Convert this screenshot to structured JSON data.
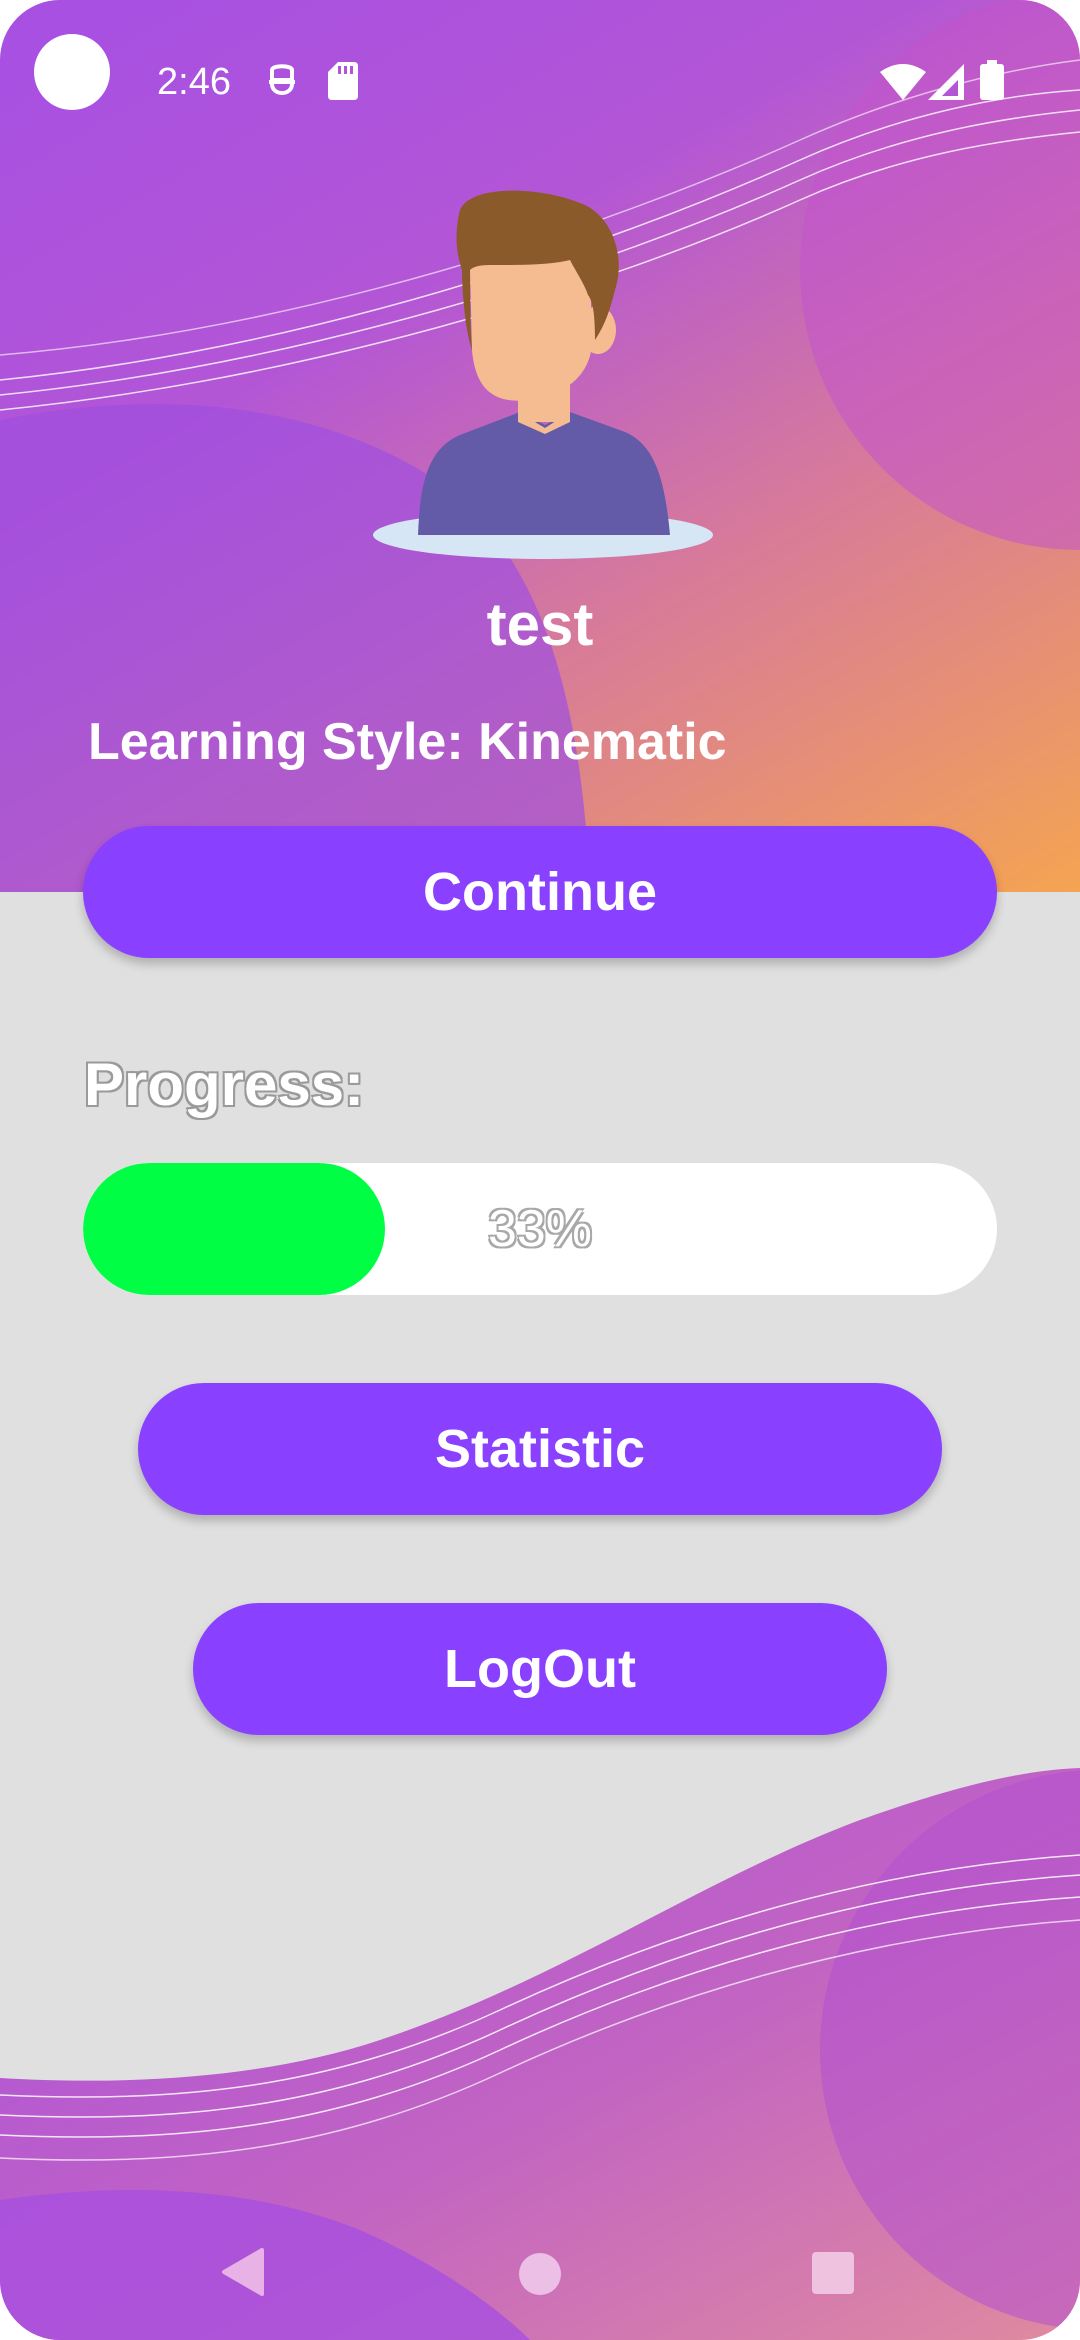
{
  "status_bar": {
    "time": "2:46",
    "icons": [
      "camera-hole",
      "notification-icon",
      "sd-card-icon",
      "wifi-icon",
      "cell-signal-icon",
      "battery-icon"
    ]
  },
  "profile": {
    "username": "test",
    "learning_style": "Learning Style: Kinematic"
  },
  "buttons": {
    "continue": "Continue",
    "statistic": "Statistic",
    "logout": "LogOut"
  },
  "progress": {
    "label": "Progress:",
    "value_text": "33%",
    "value": 0.33
  },
  "nav_bar": {
    "icons": [
      "back-icon",
      "home-icon",
      "recents-icon"
    ]
  },
  "colors": {
    "button": "#8a40ff",
    "progress_fill": "#00ff44",
    "background": "#e0e0e0",
    "gradient_start": "#a64fe3",
    "gradient_end": "#f5a452"
  }
}
